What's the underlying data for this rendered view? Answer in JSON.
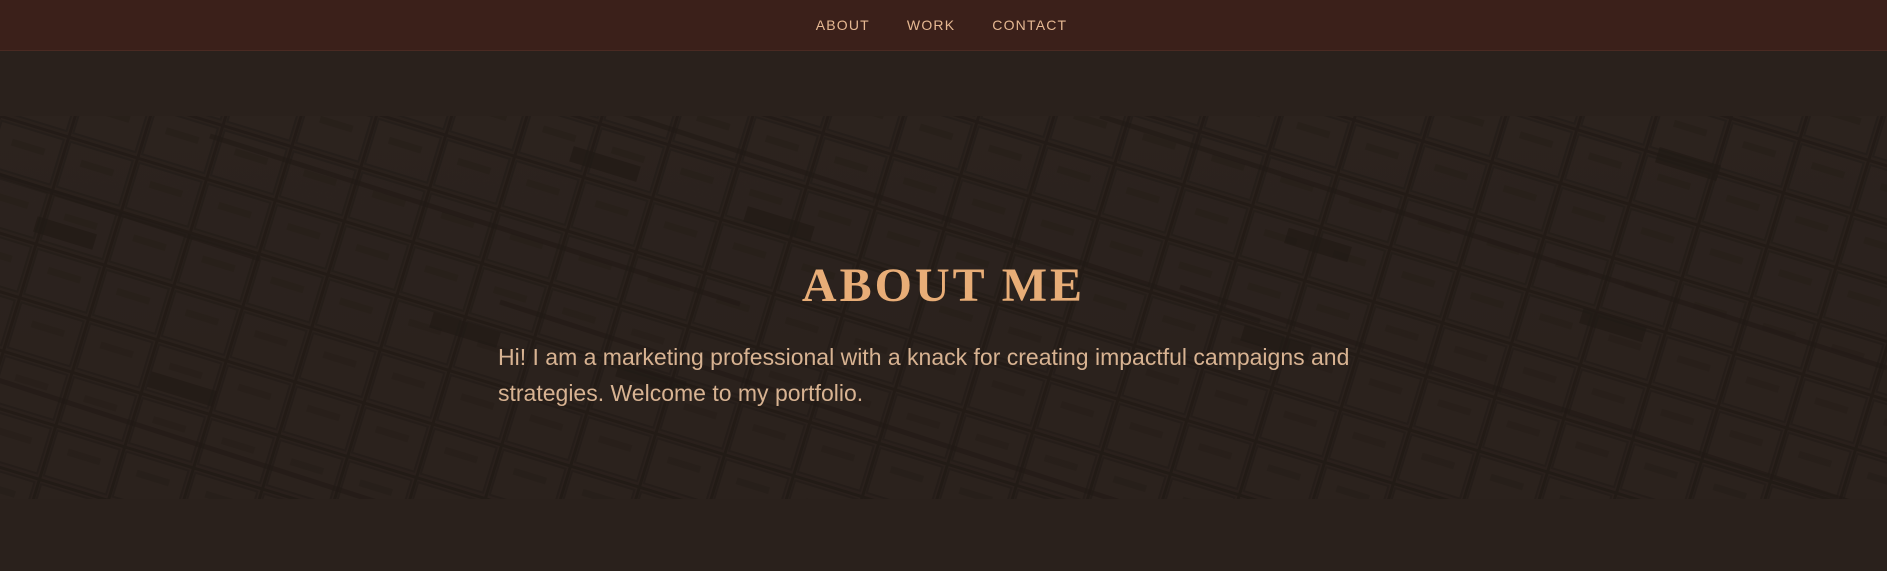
{
  "navigation": {
    "items": [
      {
        "label": "ABOUT"
      },
      {
        "label": "WORK"
      },
      {
        "label": "CONTACT"
      }
    ]
  },
  "hero": {
    "title": "ABOUT ME",
    "text": "Hi! I am a marketing professional with a knack for creating impactful campaigns and strategies. Welcome to my portfolio."
  },
  "colors": {
    "topbar": "#3b201a",
    "background": "#2a211c",
    "accent": "#e8ad77",
    "text": "#d8b392"
  }
}
